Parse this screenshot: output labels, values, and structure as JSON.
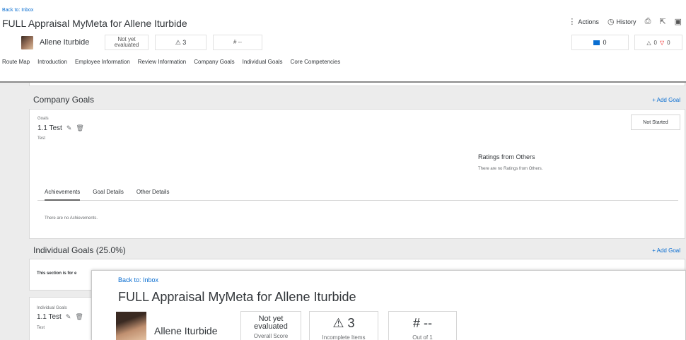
{
  "header": {
    "back_link": "Back to: Inbox",
    "title": "FULL Appraisal MyMeta for Allene Iturbide",
    "actions_label": "Actions",
    "history_label": "History",
    "employee_name": "Allene Iturbide",
    "score_label": "Not yet evaluated",
    "incomplete_count": "⚠ 3",
    "out_of_value": "# --",
    "comments_count": "0",
    "up_count": "0",
    "down_count": "0"
  },
  "tabs": [
    "Route Map",
    "Introduction",
    "Employee Information",
    "Review Information",
    "Company Goals",
    "Individual Goals",
    "Core Competencies"
  ],
  "company_goals": {
    "title": "Company Goals",
    "add_label": "+ Add Goal",
    "goals_label": "Goals",
    "goal_name": "1.1 Test",
    "goal_desc": "Test",
    "status_button": "Not Started",
    "ratings_title": "Ratings from Others",
    "ratings_empty": "There are no Ratings from Others.",
    "subtabs": [
      "Achievements",
      "Goal Details",
      "Other Details"
    ],
    "achievements_empty": "There are no Achievements."
  },
  "individual_goals": {
    "title": "Individual Goals (25.0%)",
    "add_label": "+ Add Goal",
    "notice": "This section is for e",
    "goals_label": "Individual Goals",
    "goal_name": "1.1 Test",
    "goal_desc": "Test"
  },
  "overlay": {
    "back_link": "Back to: Inbox",
    "title": "FULL Appraisal MyMeta for Allene Iturbide",
    "employee_name": "Allene Iturbide",
    "score_value": "Not yet evaluated",
    "score_caption": "Overall Score",
    "incomplete_value": "⚠ 3",
    "incomplete_caption": "Incomplete Items",
    "outof_value": "# --",
    "outof_caption": "Out of 1"
  }
}
